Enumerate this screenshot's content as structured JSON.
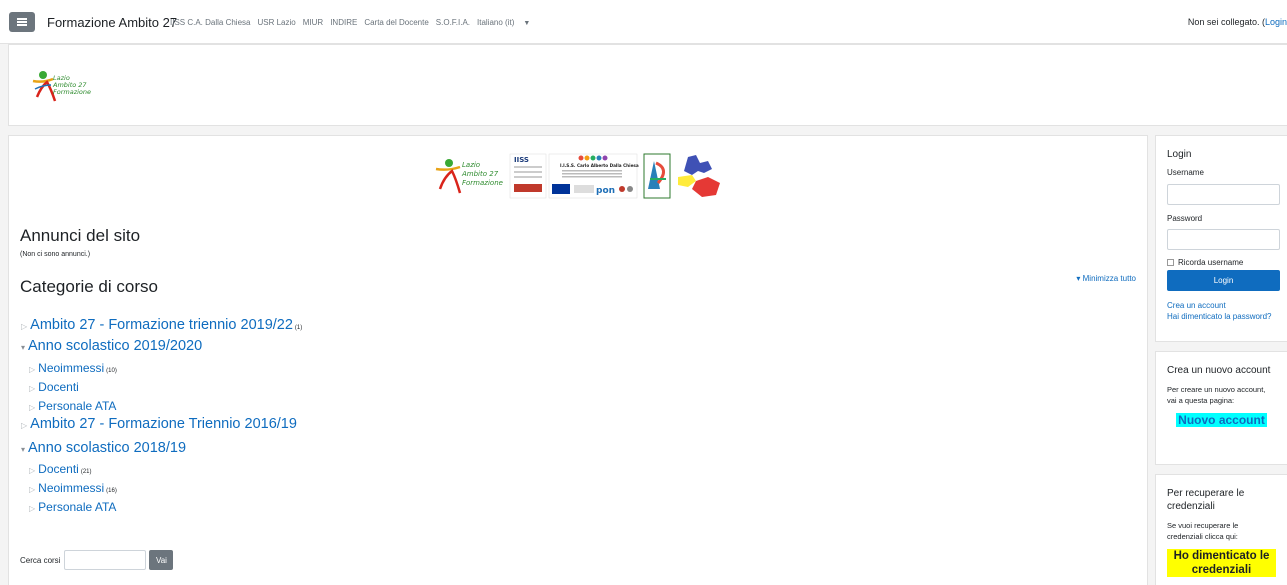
{
  "navbar": {
    "brand": "Formazione Ambito 27",
    "links": [
      "IISS C.A. Dalla Chiesa",
      "USR Lazio",
      "MIUR",
      "INDIRE",
      "Carta del Docente",
      "S.O.F.I.A."
    ],
    "language": "Italiano (it)",
    "login_status_text": "Non sei collegato. (",
    "login_link": "Login"
  },
  "header_logo": {
    "lines": [
      "Lazio",
      "Ambito 27",
      "Formazione"
    ]
  },
  "banner": {
    "logo_lines": [
      "Lazio",
      "Ambito 27",
      "Formazione"
    ],
    "iiss_label": "IISS",
    "school_name": "I.I.S.S. Carlo Alberto Dalla Chiesa",
    "pon_label": "pon"
  },
  "main": {
    "announcements_title": "Annunci del sito",
    "no_announcements": "(Non ci sono annunci.)",
    "categories_title": "Categorie di corso",
    "collapse_all": "Minimizza tutto",
    "categories": [
      {
        "label": "Ambito 27 - Formazione triennio 2019/22",
        "count": "(1)",
        "level": 1,
        "open": false
      },
      {
        "label": "Anno scolastico 2019/2020",
        "count": "",
        "level": 1,
        "open": true
      },
      {
        "label": "Neoimmessi",
        "count": "(10)",
        "level": 2,
        "open": false
      },
      {
        "label": "Docenti",
        "count": "",
        "level": 2,
        "open": false
      },
      {
        "label": "Personale ATA",
        "count": "",
        "level": 2,
        "open": false
      },
      {
        "label": "Ambito 27 - Formazione Triennio 2016/19",
        "count": "",
        "level": 1,
        "open": false
      },
      {
        "label": "Anno scolastico 2018/19",
        "count": "",
        "level": 1,
        "open": true
      },
      {
        "label": "Docenti",
        "count": "(21)",
        "level": 2,
        "open": false
      },
      {
        "label": "Neoimmessi",
        "count": "(16)",
        "level": 2,
        "open": false
      },
      {
        "label": "Personale ATA",
        "count": "",
        "level": 2,
        "open": false
      }
    ],
    "search_label": "Cerca corsi",
    "search_button": "Vai"
  },
  "login_block": {
    "title": "Login",
    "username_label": "Username",
    "password_label": "Password",
    "remember_label": "Ricorda username",
    "login_button": "Login",
    "create_account_link": "Crea un account",
    "forgot_link": "Hai dimenticato la password?"
  },
  "create_block": {
    "title": "Crea un nuovo account",
    "text": "Per creare un nuovo account, vai a questa pagina:",
    "link": "Nuovo account"
  },
  "recover_block": {
    "title": "Per recuperare le credenziali",
    "text": "Se vuoi recuperare le credenziali clicca qui:",
    "link": "Ho dimenticato le credenziali"
  },
  "colors": {
    "link_blue": "#0f6cbf",
    "cyan_highlight": "#00ffff",
    "yellow_highlight": "#ffff00",
    "secondary_button": "#6c757d"
  }
}
